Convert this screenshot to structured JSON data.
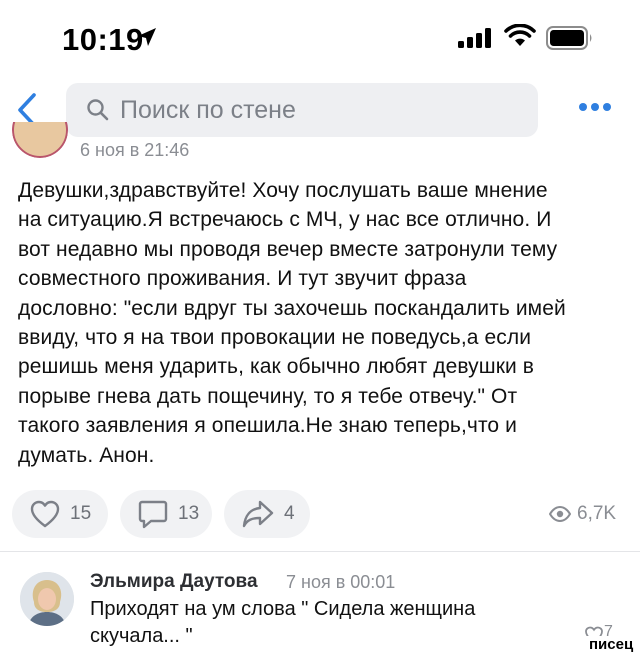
{
  "status_bar": {
    "time": "10:19"
  },
  "header": {
    "search_placeholder": "Поиск по стене"
  },
  "post": {
    "date": "6 ноя в 21:46",
    "text": "Девушки,здравствуйте! Хочу послушать ваше мнение\nна ситуацию.Я встречаюсь с МЧ, у нас все отлично. И\nвот недавно мы проводя вечер вместе затронули тему\nсовместного проживания. И тут звучит фраза\nдословно: \"если вдруг ты захочешь поскандалить имей\nввиду, что я на твои провокации не поведусь,а если\nрешишь меня ударить, как обычно любят девушки в\nпорыве гнева дать пощечину, то я тебе отвечу.\" От\nтакого заявления я опешила.Не знаю теперь,что и\nдумать. Анон.",
    "likes": "15",
    "comments": "13",
    "shares": "4",
    "views": "6,7K"
  },
  "comment": {
    "author": "Эльмира Даутова",
    "time": "7 ноя в 00:01",
    "text": "Приходят на ум слова \" Сидела женщина\nскучала... \"",
    "likes": "7"
  },
  "watermark": "писец",
  "colors": {
    "accent": "#2f7fe0",
    "icon_gray": "#8a8d93",
    "button_bg": "#f1f2f4"
  }
}
